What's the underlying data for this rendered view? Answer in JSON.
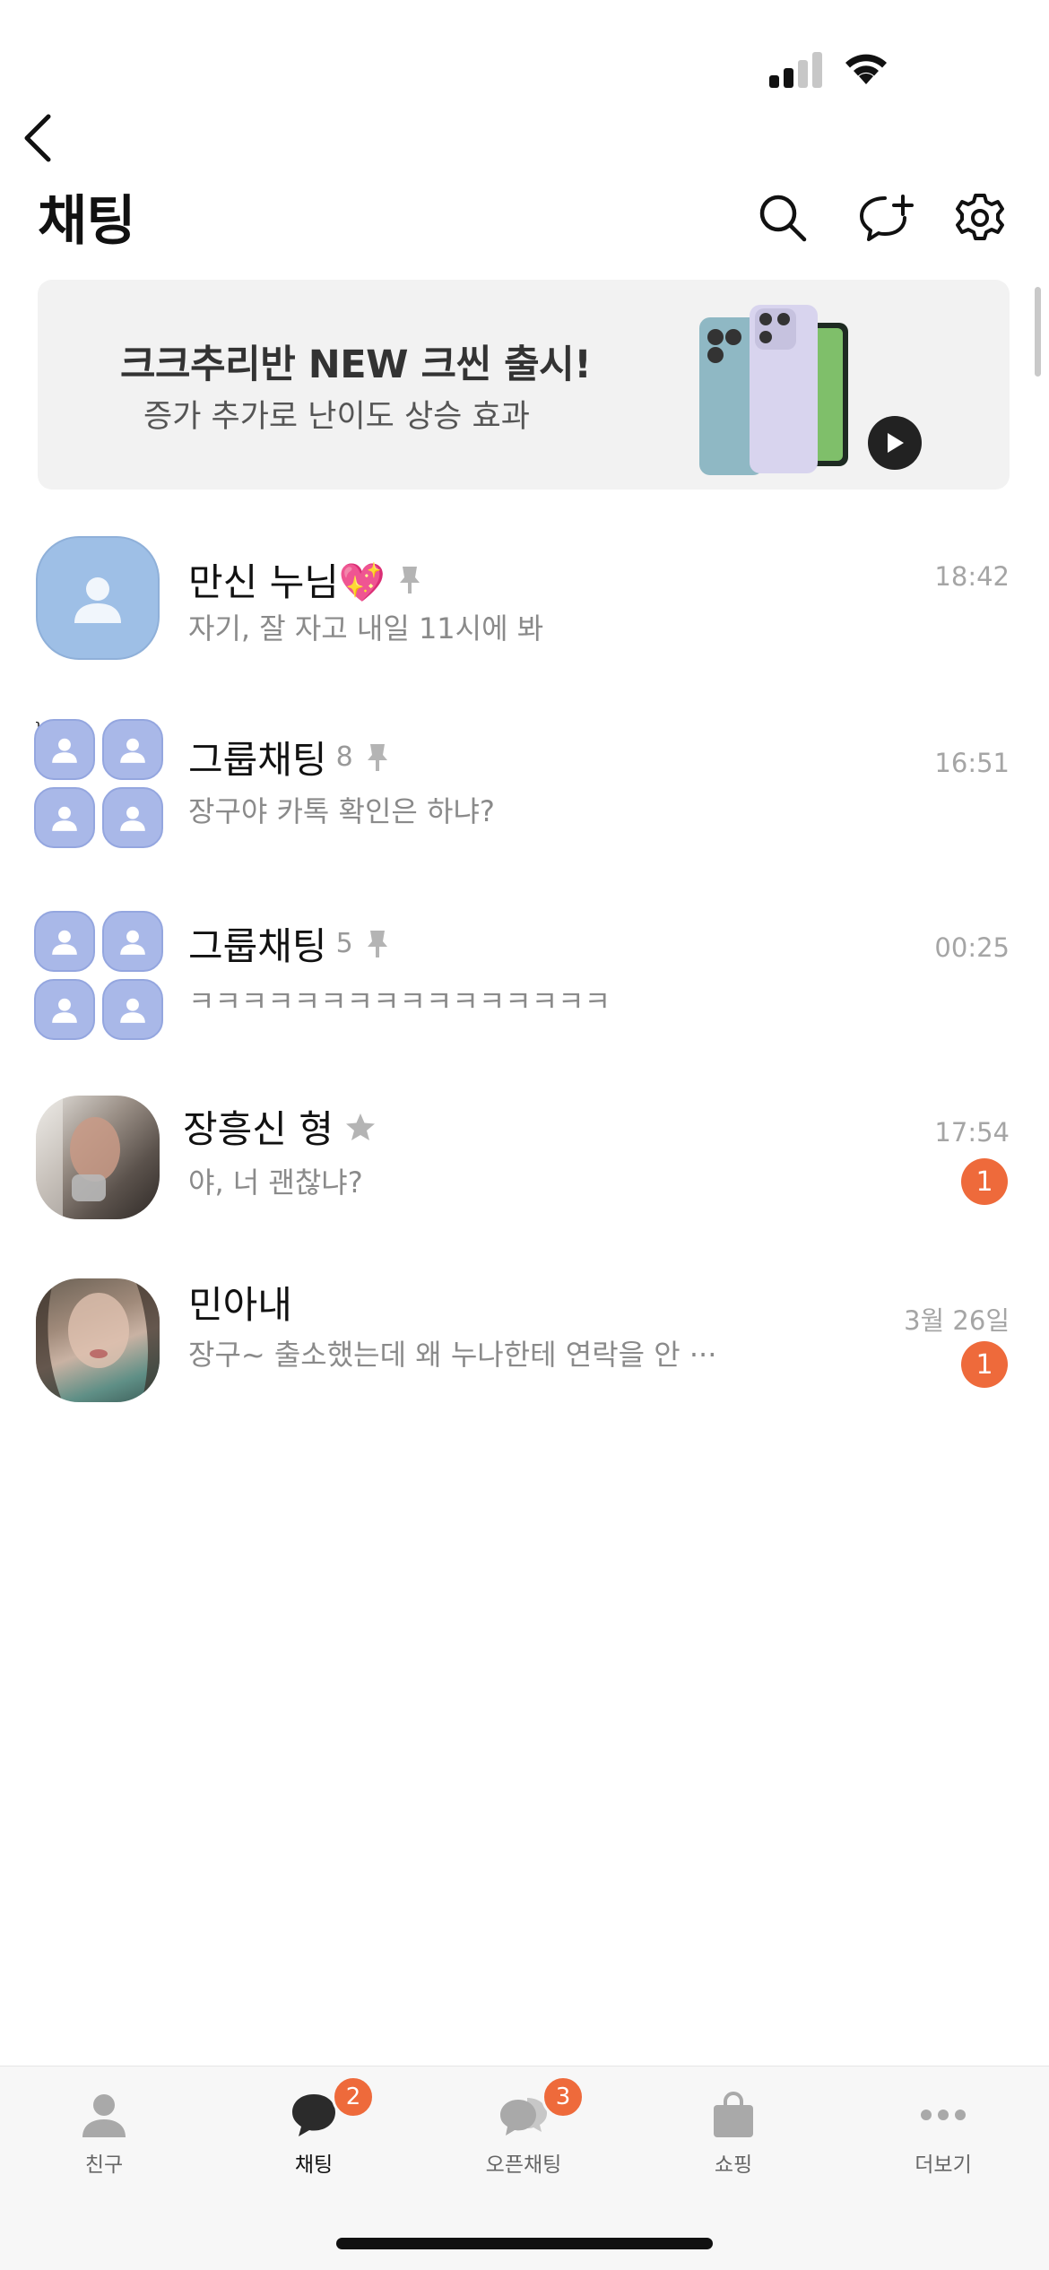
{
  "header": {
    "title": "채팅",
    "icons": [
      "back-arrow-icon",
      "search-icon",
      "new-chat-icon",
      "settings-gear-icon"
    ]
  },
  "banner": {
    "title": "크크추리반 NEW 크씬 출시!",
    "subtitle": "증가 추가로 난이도 상승 효과"
  },
  "chats": [
    {
      "name": "만신 누님💖",
      "count": "",
      "pinned": true,
      "message": "자기, 잘 자고 내일 11시에 봐",
      "time": "18:42",
      "unread": ""
    },
    {
      "name": "그룹채팅",
      "count": "8",
      "pinned": true,
      "message": "장구야 카톡 확인은 하냐?",
      "time": "16:51",
      "unread": ""
    },
    {
      "name": "그룹채팅",
      "count": "5",
      "pinned": true,
      "message": "ㅋㅋㅋㅋㅋㅋㅋㅋㅋㅋㅋㅋㅋㅋㅋㅋ",
      "time": "00:25",
      "unread": ""
    },
    {
      "name": "장흥신 형",
      "count": "",
      "favorite": true,
      "message": "야, 너 괜찮냐?",
      "time": "17:54",
      "unread": "1"
    },
    {
      "name": "민아내",
      "count": "",
      "message": "장구~ 출소했는데 왜 누나한테 연락을 안 ···",
      "time": "3월 26일",
      "unread": "1"
    }
  ],
  "tabs": [
    {
      "label": "친구",
      "badge": "",
      "active": false
    },
    {
      "label": "채팅",
      "badge": "2",
      "active": true
    },
    {
      "label": "오픈채팅",
      "badge": "3",
      "active": false
    },
    {
      "label": "쇼핑",
      "badge": "",
      "active": false
    },
    {
      "label": "더보기",
      "badge": "",
      "active": false
    }
  ],
  "colors": {
    "accent_badge": "#ee6a3b",
    "banner_bg": "#f2f2f2",
    "default_avatar": "#9ebfe6",
    "group_avatar": "#a9b8e8"
  }
}
